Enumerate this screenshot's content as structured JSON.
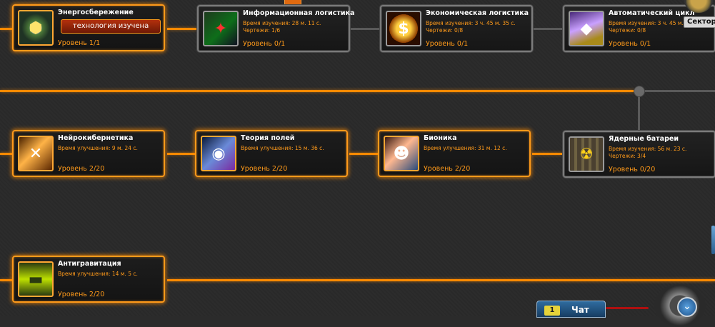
{
  "rows": [
    [
      {
        "id": "energy",
        "state": "active",
        "icon": "energy-icon",
        "title": "Энергосбережение",
        "status_button": "технология изучена",
        "level": "Уровень 1/1"
      },
      {
        "id": "infolog",
        "state": "locked",
        "icon": "network-icon",
        "title": "Информационная логистика",
        "line1": "Время изучения: 28 м. 11 с.",
        "line2": "Чертежи: 1/6",
        "level": "Уровень 0/1"
      },
      {
        "id": "econ",
        "state": "locked",
        "icon": "dollar-icon",
        "title": "Экономическая логистика",
        "line1": "Время изучения: 3 ч. 45 м. 35 с.",
        "line2": "Чертежи: 0/8",
        "level": "Уровень 0/1"
      },
      {
        "id": "auto",
        "state": "locked",
        "icon": "crystal-icon",
        "title": "Автоматический цикл",
        "line1": "Время изучения: 3 ч. 45 м. 35 с.",
        "line2": "Чертежи: 0/8",
        "level": "Уровень 0/1"
      }
    ],
    [
      {
        "id": "neuro",
        "state": "active",
        "icon": "dna-icon",
        "title": "Нейрокибернетика",
        "line1": "Время улучшения: 9 м. 24 с.",
        "level": "Уровень 2/20"
      },
      {
        "id": "fields",
        "state": "active",
        "icon": "robot-icon",
        "title": "Теория полей",
        "line1": "Время улучшения: 15 м. 36 с.",
        "level": "Уровень 2/20"
      },
      {
        "id": "bionic",
        "state": "active",
        "icon": "cyborg-icon",
        "title": "Бионика",
        "line1": "Время улучшения: 31 м. 12 с.",
        "level": "Уровень 2/20"
      },
      {
        "id": "nuclear",
        "state": "locked",
        "icon": "battery-icon",
        "title": "Ядерные батареи",
        "line1": "Время изучения: 56 м. 23 с.",
        "line2": "Чертежи: 3/4",
        "level": "Уровень 0/20"
      }
    ],
    [
      {
        "id": "antigrav",
        "state": "active",
        "icon": "antigravity-icon",
        "title": "Антигравитация",
        "line1": "Время улучшения: 14 м. 5 с.",
        "level": "Уровень 2/20"
      }
    ]
  ],
  "sector_tab": "Сектор",
  "chat": {
    "count": "1",
    "label": "Чат"
  },
  "colors": {
    "accent": "#ff9a1a",
    "locked_border": "#7b7b7b",
    "background": "#2b2b2b"
  }
}
